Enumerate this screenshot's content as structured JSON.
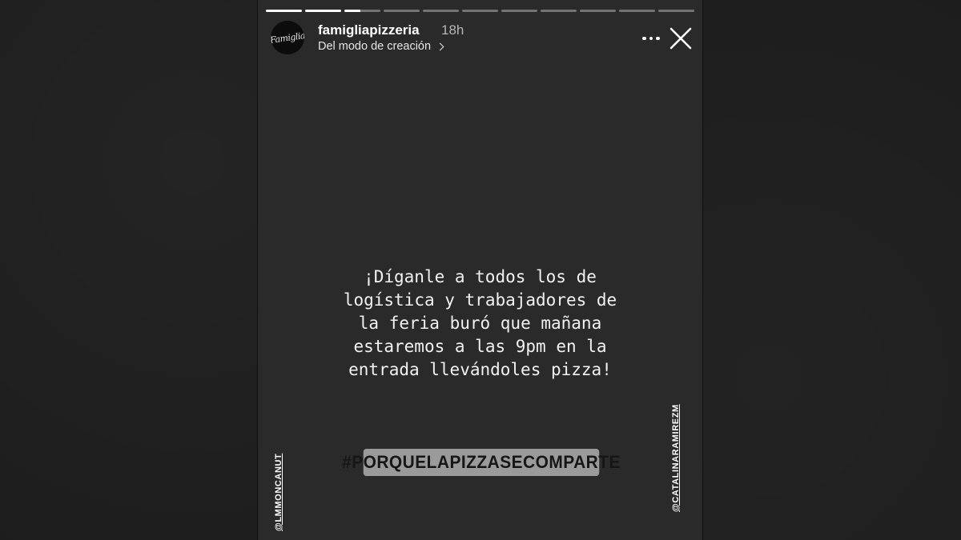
{
  "story": {
    "account": {
      "username": "famigliapizzeria",
      "time_ago": "18h",
      "source_label": "Del modo de creación",
      "avatar_text": "Famiglia"
    },
    "progress": {
      "segments": 11,
      "current_index": 2,
      "current_fraction": 0.45
    },
    "caption": "¡Díganle a todos los de\nlogística y trabajadores de\nla feria buró que mañana\nestaremos a las 9pm en la\nentrada llevándoles pizza!",
    "hashtag": "#PORQUELAPIZZASECOMPARTE",
    "mentions": {
      "left": "@LMMONCANUT",
      "right": "@CATALINARAMIREZM"
    }
  },
  "icons": {
    "more": "more-options-icon",
    "close": "close-icon",
    "chevron": "chevron-right-icon"
  },
  "colors": {
    "story_background": "#2a2a2a",
    "hashtag_background": "#9a9a9a",
    "text": "#ffffff"
  }
}
